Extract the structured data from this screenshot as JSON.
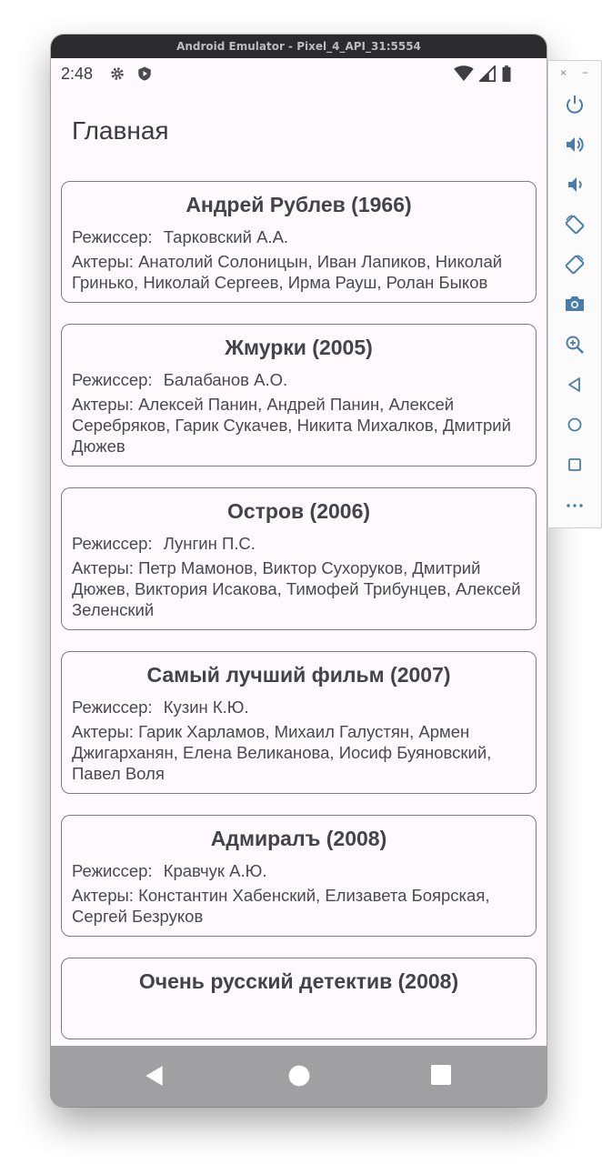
{
  "window": {
    "title": "Android Emulator - Pixel_4_API_31:5554"
  },
  "status_bar": {
    "time": "2:48"
  },
  "app": {
    "title": "Главная"
  },
  "movies": [
    {
      "title": "Андрей Рублев (1966)",
      "director_label": "Режиссер:",
      "director": "Тарковский А.А.",
      "actors_label": "Актеры:",
      "actors": "Анатолий Солоницын, Иван Лапиков, Николай Гринько, Николай Сергеев, Ирма Рауш, Ролан Быков"
    },
    {
      "title": "Жмурки (2005)",
      "director_label": "Режиссер:",
      "director": "Балабанов А.О.",
      "actors_label": "Актеры:",
      "actors": "Алексей Панин, Андрей Панин, Алексей Серебряков, Гарик Сукачев, Никита Михалков, Дмитрий Дюжев"
    },
    {
      "title": "Остров (2006)",
      "director_label": "Режиссер:",
      "director": "Лунгин П.С.",
      "actors_label": "Актеры:",
      "actors": "Петр Мамонов, Виктор Сухоруков, Дмитрий Дюжев, Виктория Исакова, Тимофей Трибунцев, Алексей Зеленский"
    },
    {
      "title": "Самый лучший фильм (2007)",
      "director_label": "Режиссер:",
      "director": "Кузин К.Ю.",
      "actors_label": "Актеры:",
      "actors": "Гарик Харламов, Михаил Галустян, Армен Джигарханян, Елена Великанова, Иосиф Буяновский, Павел Воля"
    },
    {
      "title": "Адмиралъ (2008)",
      "director_label": "Режиссер:",
      "director": "Кравчук А.Ю.",
      "actors_label": "Актеры:",
      "actors": "Константин Хабенский, Елизавета Боярская, Сергей Безруков"
    },
    {
      "title": "Очень русский детектив (2008)",
      "director_label": "",
      "director": "",
      "actors_label": "",
      "actors": ""
    }
  ],
  "side_panel": {
    "close_glyph": "×",
    "minimize_glyph": "−",
    "icons": [
      "power-icon",
      "volume-up-icon",
      "volume-down-icon",
      "rotate-left-icon",
      "rotate-right-icon",
      "camera-icon",
      "zoom-icon",
      "back-icon",
      "home-icon",
      "overview-icon",
      "more-icon"
    ]
  }
}
